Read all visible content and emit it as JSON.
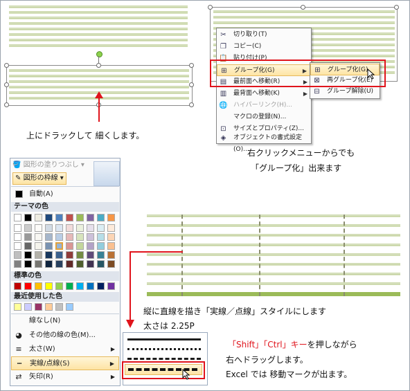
{
  "captions": {
    "drag_up": "上にドラックして 細くします。",
    "right_click_line1": "右クリックメニューからでも",
    "right_click_line2": "「グループ化」出来ます",
    "vertical_line_1": "縦に直線を描き「実線／点線」スタイルにします",
    "vertical_line_2": "太さは 2.25P",
    "shift_ctrl_1": "「Shift」「Ctrl」キー",
    "shift_ctrl_1b": "を押しながら",
    "shift_ctrl_2": "右へドラッグします。",
    "shift_ctrl_3": "Excel では 移動マークが出ます。"
  },
  "context_menu": {
    "items": [
      {
        "icon": "scissors-icon",
        "glyph": "✂",
        "label": "切り取り(T)",
        "disabled": false,
        "submenu": false
      },
      {
        "icon": "copy-icon",
        "glyph": "❐",
        "label": "コピー(C)",
        "disabled": false,
        "submenu": false
      },
      {
        "icon": "paste-icon",
        "glyph": "📋",
        "label": "貼り付け(P)",
        "disabled": false,
        "submenu": false
      },
      {
        "icon": "group-icon",
        "glyph": "⊞",
        "label": "グループ化(G)",
        "disabled": false,
        "submenu": true
      },
      {
        "icon": "bring-forward-icon",
        "glyph": "▤",
        "label": "最前面へ移動(R)",
        "disabled": false,
        "submenu": true
      },
      {
        "icon": "send-backward-icon",
        "glyph": "▥",
        "label": "最背面へ移動(K)",
        "disabled": false,
        "submenu": true
      },
      {
        "icon": "hyperlink-icon",
        "glyph": "🌐",
        "label": "ハイパーリンク(H)...",
        "disabled": true,
        "submenu": false
      },
      {
        "icon": "macro-icon",
        "glyph": "",
        "label": "マクロの登録(N)...",
        "disabled": false,
        "submenu": false
      },
      {
        "icon": "size-icon",
        "glyph": "⊡",
        "label": "サイズとプロパティ(Z)...",
        "disabled": false,
        "submenu": false
      },
      {
        "icon": "format-object-icon",
        "glyph": "◈",
        "label": "オブジェクトの書式設定(O)...",
        "disabled": false,
        "submenu": false
      }
    ],
    "submenu": [
      {
        "icon": "group-icon",
        "glyph": "⊞",
        "label": "グループ化(G)"
      },
      {
        "icon": "regroup-icon",
        "glyph": "⊠",
        "label": "再グループ化(E)"
      },
      {
        "icon": "ungroup-icon",
        "glyph": "⊟",
        "label": "グループ解除(U)"
      }
    ]
  },
  "line_panel": {
    "ribbon_fill": "図形の塗りつぶし",
    "ribbon_outline": "図形の枠線",
    "auto": "自動(A)",
    "theme_colors_title": "テーマの色",
    "standard_colors_title": "標準の色",
    "recent_colors_title": "最近使用した色",
    "no_line": "線なし(N)",
    "other_colors": "その他の線の色(M)...",
    "weight": "太さ(W)",
    "dashes": "実線/点線(S)",
    "arrows": "矢印(R)",
    "theme_row": [
      "#ffffff",
      "#000000",
      "#eeece1",
      "#1f497d",
      "#4f81bd",
      "#c0504d",
      "#9bbb59",
      "#8064a2",
      "#4bacc6",
      "#f79646"
    ],
    "standard_row": [
      "#c00000",
      "#ff0000",
      "#ffc000",
      "#ffff00",
      "#92d050",
      "#00b050",
      "#00b0f0",
      "#0070c0",
      "#002060",
      "#7030a0"
    ],
    "recent_row": [
      "#ffff99",
      "#ccccff",
      "#993366",
      "#ffcc99",
      "#c0c0c0",
      "#99ccff"
    ]
  },
  "colors": {
    "accent_red": "#e0141c",
    "highlight_orange": "#fde4a4"
  }
}
